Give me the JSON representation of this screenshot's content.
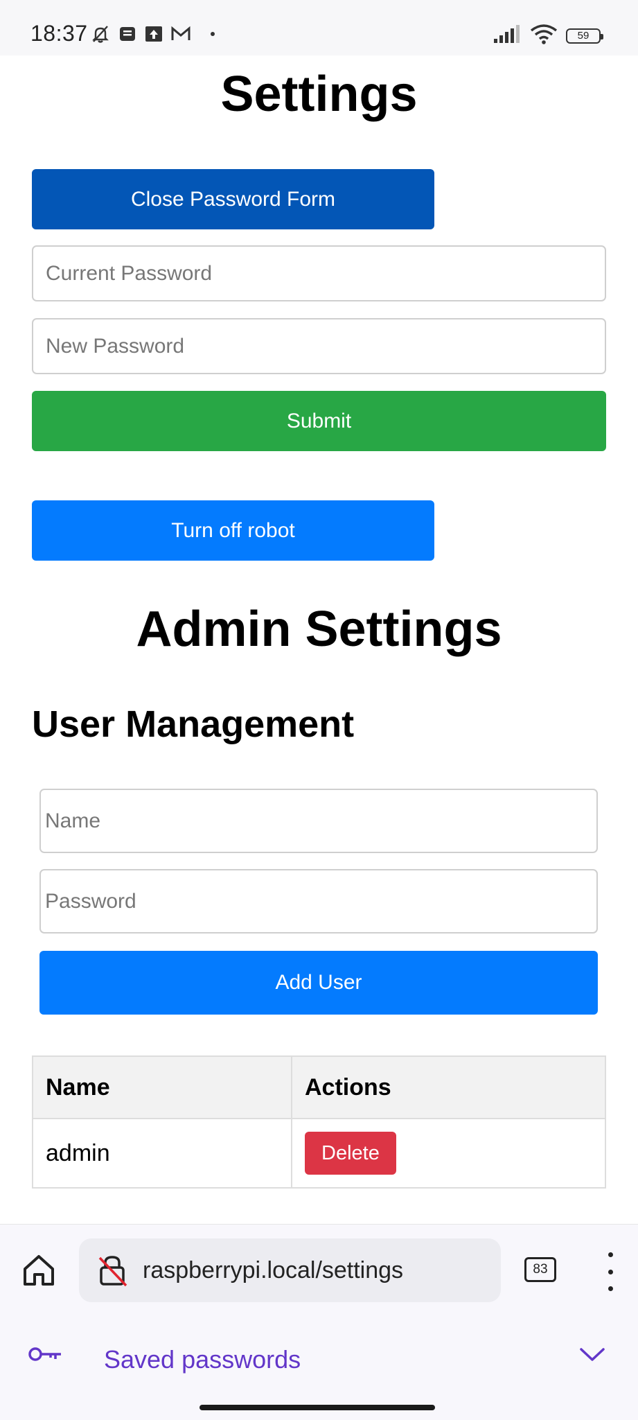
{
  "status_bar": {
    "time": "18:37",
    "battery": "59"
  },
  "page": {
    "title": "Settings",
    "close_form_label": "Close Password Form",
    "current_password_placeholder": "Current Password",
    "new_password_placeholder": "New Password",
    "submit_label": "Submit",
    "turn_off_label": "Turn off robot",
    "admin_title": "Admin Settings",
    "user_management_title": "User Management",
    "name_placeholder": "Name",
    "password_placeholder": "Password",
    "add_user_label": "Add User",
    "table": {
      "columns": [
        "Name",
        "Actions"
      ],
      "rows": [
        {
          "name": "admin",
          "action": "Delete"
        }
      ]
    }
  },
  "browser": {
    "url": "raspberrypi.local/settings",
    "tab_count": "83",
    "saved_passwords_label": "Saved passwords"
  },
  "colors": {
    "close_form_button": "#0356b6",
    "submit_button": "#28a745",
    "primary_button": "#047bfe",
    "delete_button": "#dc3545",
    "saved_passwords_text": "#6236c9"
  },
  "icons": {
    "status_left": [
      "silent-bell-icon",
      "message-icon",
      "upload-icon",
      "gmail-icon"
    ],
    "status_right": [
      "signal-icon",
      "wifi-icon",
      "battery-icon"
    ],
    "browser": [
      "home-icon",
      "insecure-lock-icon",
      "tabs-icon",
      "more-menu-icon",
      "key-icon",
      "chevron-down-icon"
    ]
  }
}
